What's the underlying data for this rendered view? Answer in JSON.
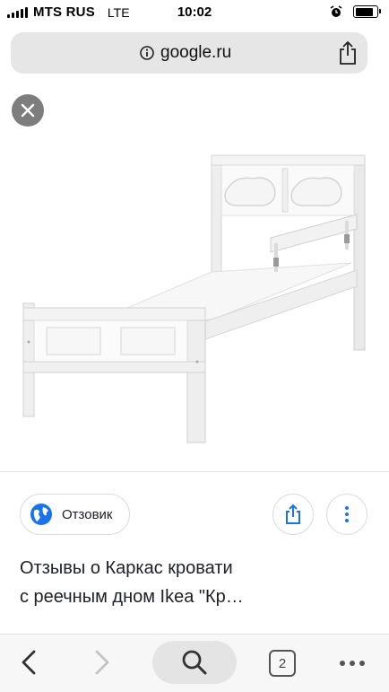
{
  "status_bar": {
    "carrier": "MTS RUS",
    "network": "LTE",
    "time": "10:02",
    "battery_level": 0.85,
    "icons": [
      "signal-icon",
      "alarm-icon",
      "battery-icon"
    ]
  },
  "url_bar": {
    "domain": "google.ru",
    "icons": [
      "info-icon",
      "share-icon"
    ]
  },
  "viewer": {
    "close_icon": "close-icon",
    "image_subject": "white child bed frame with guard rail"
  },
  "result": {
    "source_name": "Отзовик",
    "title_line1": "Отзывы о Каркас кровати",
    "title_line2": "с реечным дном Ikea \"Кр…",
    "icons": [
      "globe-icon",
      "share-icon",
      "more-vertical-icon"
    ]
  },
  "toolbar": {
    "tab_count": "2",
    "icons": [
      "back-icon",
      "forward-icon",
      "search-icon",
      "tabs-icon",
      "more-horizontal-icon"
    ]
  },
  "colors": {
    "accent": "#1a73e8",
    "url_bar_bg": "#e6e6e6",
    "close_button_bg": "#7d7d7d",
    "toolbar_bg": "#f7f7f7"
  }
}
